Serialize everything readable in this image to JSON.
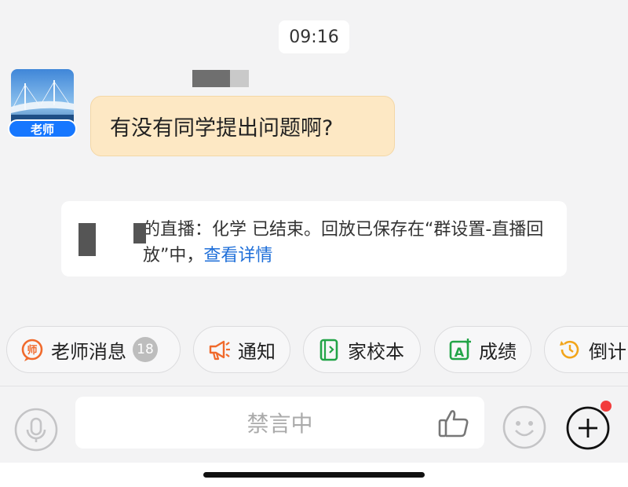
{
  "timestamp": "09:16",
  "teacher": {
    "avatar_badge": "老师",
    "message": "有没有同学提出问题啊?"
  },
  "notice": {
    "text": "的直播：化学 已结束。回放已保存在“群设置-直播回放”中，",
    "link": "查看详情"
  },
  "quick_actions": [
    {
      "label": "老师消息",
      "badge": "18",
      "icon": "teacher-message-icon",
      "color": "#f06a2c"
    },
    {
      "label": "通知",
      "icon": "megaphone-icon",
      "color": "#f06a2c"
    },
    {
      "label": "家校本",
      "icon": "notebook-icon",
      "color": "#22a447"
    },
    {
      "label": "成绩",
      "icon": "grade-icon",
      "color": "#22a447"
    },
    {
      "label": "倒计",
      "icon": "countdown-icon",
      "color": "#f2a51b"
    }
  ],
  "input": {
    "placeholder": "禁言中"
  },
  "colors": {
    "accent_blue": "#1677ff",
    "link_blue": "#1f6fd9",
    "bubble_bg": "#fde8c4",
    "notification_dot": "#f23c3c"
  }
}
